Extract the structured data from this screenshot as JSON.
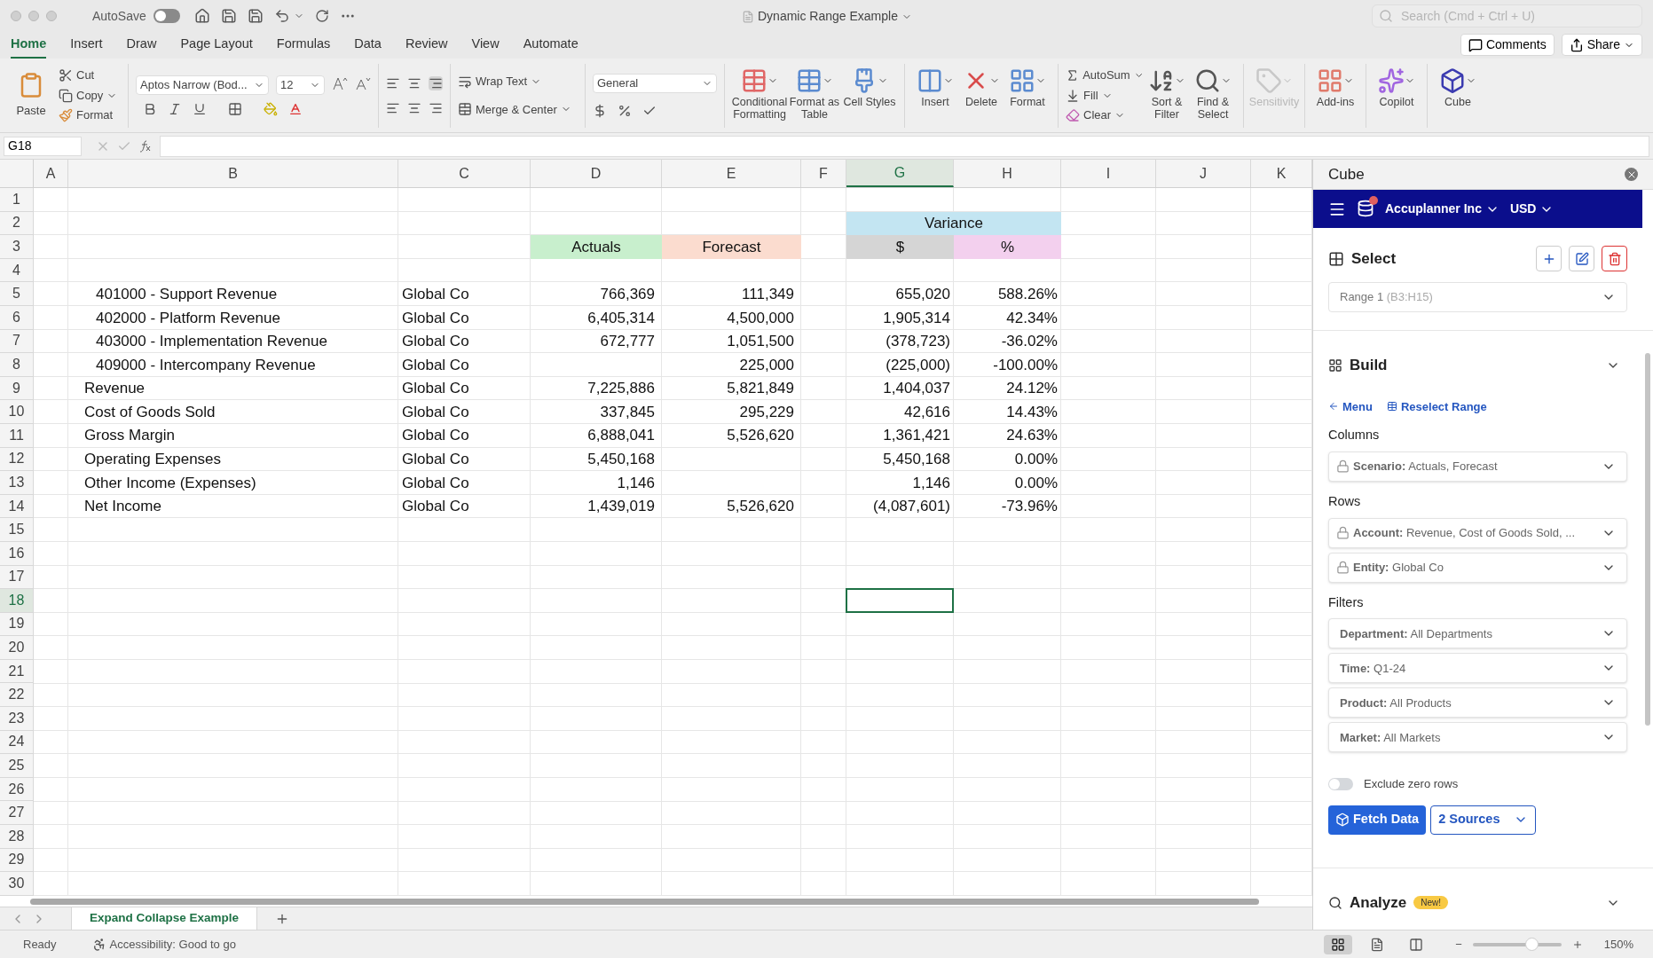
{
  "window": {
    "title": "Dynamic Range Example",
    "autosave": {
      "label": "AutoSave",
      "on": false
    },
    "search_placeholder": "Search (Cmd + Ctrl + U)"
  },
  "ribbon_tabs": [
    {
      "label": "Home",
      "selected": true
    },
    {
      "label": "Insert",
      "selected": false
    },
    {
      "label": "Draw",
      "selected": false
    },
    {
      "label": "Page Layout",
      "selected": false
    },
    {
      "label": "Formulas",
      "selected": false
    },
    {
      "label": "Data",
      "selected": false
    },
    {
      "label": "Review",
      "selected": false
    },
    {
      "label": "View",
      "selected": false
    },
    {
      "label": "Automate",
      "selected": false
    }
  ],
  "top_buttons": {
    "comments": "Comments",
    "share": "Share"
  },
  "ribbon": {
    "paste": "Paste",
    "cut": "Cut",
    "copy": "Copy",
    "format_painter": "Format",
    "font_name": "Aptos Narrow (Bod...",
    "font_size": "12",
    "wrap_text": "Wrap Text",
    "merge_center": "Merge & Center",
    "number_format": "General",
    "large_buttons": [
      {
        "label": "Conditional Formatting",
        "kind": "conditional",
        "disabled": false
      },
      {
        "label": "Format as Table",
        "kind": "table",
        "disabled": false
      },
      {
        "label": "Cell Styles",
        "kind": "styles",
        "disabled": false
      },
      {
        "label": "Insert",
        "kind": "insert",
        "disabled": false
      },
      {
        "label": "Delete",
        "kind": "delete",
        "disabled": false
      },
      {
        "label": "Format",
        "kind": "format",
        "disabled": false
      }
    ],
    "editing": {
      "autosum": "AutoSum",
      "fill": "Fill",
      "clear": "Clear"
    },
    "tail_buttons": [
      {
        "label": "Sort & Filter",
        "kind": "sort",
        "disabled": false
      },
      {
        "label": "Find & Select",
        "kind": "find",
        "disabled": false
      },
      {
        "label": "Sensitivity",
        "kind": "sensitivity",
        "disabled": true
      },
      {
        "label": "Add-ins",
        "kind": "addins",
        "disabled": false
      },
      {
        "label": "Copilot",
        "kind": "copilot",
        "disabled": false
      },
      {
        "label": "Cube",
        "kind": "cube",
        "disabled": false
      }
    ]
  },
  "formula_bar": {
    "name_box": "G18"
  },
  "sheet": {
    "columns": [
      {
        "label": "A",
        "selected": false
      },
      {
        "label": "B",
        "selected": false
      },
      {
        "label": "C",
        "selected": false
      },
      {
        "label": "D",
        "selected": false
      },
      {
        "label": "E",
        "selected": false
      },
      {
        "label": "F",
        "selected": false
      },
      {
        "label": "G",
        "selected": true
      },
      {
        "label": "H",
        "selected": false
      },
      {
        "label": "I",
        "selected": false
      },
      {
        "label": "J",
        "selected": false
      },
      {
        "label": "K",
        "selected": false
      }
    ],
    "row_numbers": [
      {
        "label": "1",
        "selected": false
      },
      {
        "label": "2",
        "selected": false
      },
      {
        "label": "3",
        "selected": false
      },
      {
        "label": "4",
        "selected": false
      },
      {
        "label": "5",
        "selected": false
      },
      {
        "label": "6",
        "selected": false
      },
      {
        "label": "7",
        "selected": false
      },
      {
        "label": "8",
        "selected": false
      },
      {
        "label": "9",
        "selected": false
      },
      {
        "label": "10",
        "selected": false
      },
      {
        "label": "11",
        "selected": false
      },
      {
        "label": "12",
        "selected": false
      },
      {
        "label": "13",
        "selected": false
      },
      {
        "label": "14",
        "selected": false
      },
      {
        "label": "15",
        "selected": false
      },
      {
        "label": "16",
        "selected": false
      },
      {
        "label": "17",
        "selected": false
      },
      {
        "label": "18",
        "selected": true
      },
      {
        "label": "19",
        "selected": false
      },
      {
        "label": "20",
        "selected": false
      },
      {
        "label": "21",
        "selected": false
      },
      {
        "label": "22",
        "selected": false
      },
      {
        "label": "23",
        "selected": false
      },
      {
        "label": "24",
        "selected": false
      },
      {
        "label": "25",
        "selected": false
      },
      {
        "label": "26",
        "selected": false
      },
      {
        "label": "27",
        "selected": false
      },
      {
        "label": "28",
        "selected": false
      },
      {
        "label": "29",
        "selected": false
      },
      {
        "label": "30",
        "selected": false
      }
    ],
    "group_header": {
      "label": "Variance",
      "color": "#c3e5f2"
    },
    "headers": [
      {
        "label": "Actuals",
        "color": "#c8efcd"
      },
      {
        "label": "Forecast",
        "color": "#fbdccf"
      },
      {
        "label": "$",
        "color": "#d5d5d5"
      },
      {
        "label": "%",
        "color": "#f3d0ee"
      }
    ],
    "rows": [
      {
        "account": "401000 - Support Revenue",
        "indented": true,
        "entity": "Global Co",
        "actuals": "766,369",
        "forecast": "111,349",
        "variance": "655,020",
        "variance_pct": "588.26%"
      },
      {
        "account": "402000 - Platform Revenue",
        "indented": true,
        "entity": "Global Co",
        "actuals": "6,405,314",
        "forecast": "4,500,000",
        "variance": "1,905,314",
        "variance_pct": "42.34%"
      },
      {
        "account": "403000 - Implementation Revenue",
        "indented": true,
        "entity": "Global Co",
        "actuals": "672,777",
        "forecast": "1,051,500",
        "variance": "(378,723)",
        "variance_pct": "-36.02%"
      },
      {
        "account": "409000 - Intercompany Revenue",
        "indented": true,
        "entity": "Global Co",
        "forecast": "225,000",
        "variance": "(225,000)",
        "variance_pct": "-100.00%"
      },
      {
        "account": "Revenue",
        "indented": false,
        "entity": "Global Co",
        "actuals": "7,225,886",
        "forecast": "5,821,849",
        "variance": "1,404,037",
        "variance_pct": "24.12%"
      },
      {
        "account": "Cost of Goods Sold",
        "indented": false,
        "entity": "Global Co",
        "actuals": "337,845",
        "forecast": "295,229",
        "variance": "42,616",
        "variance_pct": "14.43%"
      },
      {
        "account": "Gross Margin",
        "indented": false,
        "entity": "Global Co",
        "actuals": "6,888,041",
        "forecast": "5,526,620",
        "variance": "1,361,421",
        "variance_pct": "24.63%"
      },
      {
        "account": "Operating Expenses",
        "indented": false,
        "entity": "Global Co",
        "actuals": "5,450,168",
        "variance": "5,450,168",
        "variance_pct": "0.00%"
      },
      {
        "account": "Other Income (Expenses)",
        "indented": false,
        "entity": "Global Co",
        "actuals": "1,146",
        "variance": "1,146",
        "variance_pct": "0.00%"
      },
      {
        "account": "Net Income",
        "indented": false,
        "entity": "Global Co",
        "actuals": "1,439,019",
        "forecast": "5,526,620",
        "variance": "(4,087,601)",
        "variance_pct": "-73.96%"
      }
    ],
    "sheet_tabs": [
      {
        "label": "Expand Collapse Example",
        "selected": true
      }
    ]
  },
  "panel": {
    "title": "Cube",
    "company": "Accuplanner Inc",
    "currency": "USD",
    "notification": true,
    "select": {
      "title": "Select",
      "range": "Range 1",
      "range_ref": "(B3:H15)"
    },
    "build": {
      "title": "Build",
      "expanded": true,
      "back_link": "Menu",
      "reselect_link": "Reselect Range",
      "groups": [
        {
          "title": "Columns",
          "fields": [
            {
              "label": "Scenario:",
              "value": "Actuals, Forecast",
              "locked": true
            }
          ]
        },
        {
          "title": "Rows",
          "fields": [
            {
              "label": "Account:",
              "value": "Revenue, Cost of Goods Sold, ...",
              "locked": true
            },
            {
              "label": "Entity:",
              "value": "Global Co",
              "locked": true
            }
          ]
        },
        {
          "title": "Filters",
          "fields": [
            {
              "label": "Department:",
              "value": "All Departments",
              "locked": false
            },
            {
              "label": "Time:",
              "value": "Q1-24",
              "locked": false
            },
            {
              "label": "Product:",
              "value": "All Products",
              "locked": false
            },
            {
              "label": "Market:",
              "value": "All Markets",
              "locked": false
            }
          ]
        }
      ],
      "exclude_zero": {
        "label": "Exclude zero rows",
        "on": false
      },
      "fetch": "Fetch Data",
      "sources": "2 Sources"
    },
    "analyze": {
      "title": "Analyze",
      "badge": "New!"
    }
  },
  "status_bar": {
    "ready": "Ready",
    "accessibility": "Accessibility: Good to go",
    "views": [
      {
        "kind": "normal",
        "selected": true
      },
      {
        "kind": "page",
        "selected": false
      },
      {
        "kind": "break",
        "selected": false
      }
    ],
    "zoom": {
      "level": 0.66,
      "minus": "−"
    },
    "zoom_label": "150%"
  }
}
